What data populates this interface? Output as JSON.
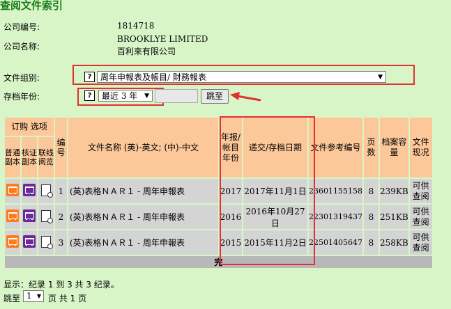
{
  "page": {
    "title": "查阅文件索引"
  },
  "company": {
    "number_label": "公司编号:",
    "number_value": "1814718",
    "name_label": "公司名称:",
    "name_en": "BROOKLYE LIMITED",
    "name_zh": "百利來有限公司"
  },
  "filters": {
    "doc_group_label": "文件组别:",
    "doc_group_value": "周年申報表及帳目/ 財務報表",
    "year_label": "存档年份:",
    "year_value": "最近 3 年",
    "help_glyph": "?",
    "jump_button": "跳至"
  },
  "table": {
    "headers": {
      "order": "订购 选项",
      "order_sub": [
        "普通副本",
        "核证副本",
        "联线阅览"
      ],
      "num": "编号",
      "doc_name": "文件名称 (英)-英文; (中)-中文",
      "year": "年报/帐目年份",
      "filed": "递交/存档日期",
      "ref": "文件参考编号",
      "pages": "页数",
      "size": "档案容量",
      "status": "文件现况"
    },
    "rows": [
      {
        "num": "1",
        "doc_name": "(英)表格ＮＡＲ１ - 周年申報表",
        "year": "2017",
        "filed": "2017年11月1日",
        "ref": "23601155158",
        "pages": "8",
        "size": "239KB",
        "status": "可供查阅"
      },
      {
        "num": "2",
        "doc_name": "(英)表格ＮＡＲ１ - 周年申報表",
        "year": "2016",
        "filed": "2016年10月27日",
        "ref": "22301319437",
        "pages": "8",
        "size": "251KB",
        "status": "可供查阅"
      },
      {
        "num": "3",
        "doc_name": "(英)表格ＮＡＲ１ - 周年申報表",
        "year": "2015",
        "filed": "2015年11月2日",
        "ref": "22501405647",
        "pages": "8",
        "size": "258KB",
        "status": "可供查阅"
      }
    ],
    "end_text": "完"
  },
  "footer": {
    "display_text": "显示：纪录 1 到 3 共 3 纪录。",
    "jump_label": "跳至",
    "page_value": "1",
    "page_suffix": "页 共 1 页"
  },
  "colors": {
    "background": "#d8f5c8",
    "header": "#fcc89a",
    "row": "#d4d4d4",
    "annotation": "#e03030",
    "title": "#1a7a1a"
  }
}
